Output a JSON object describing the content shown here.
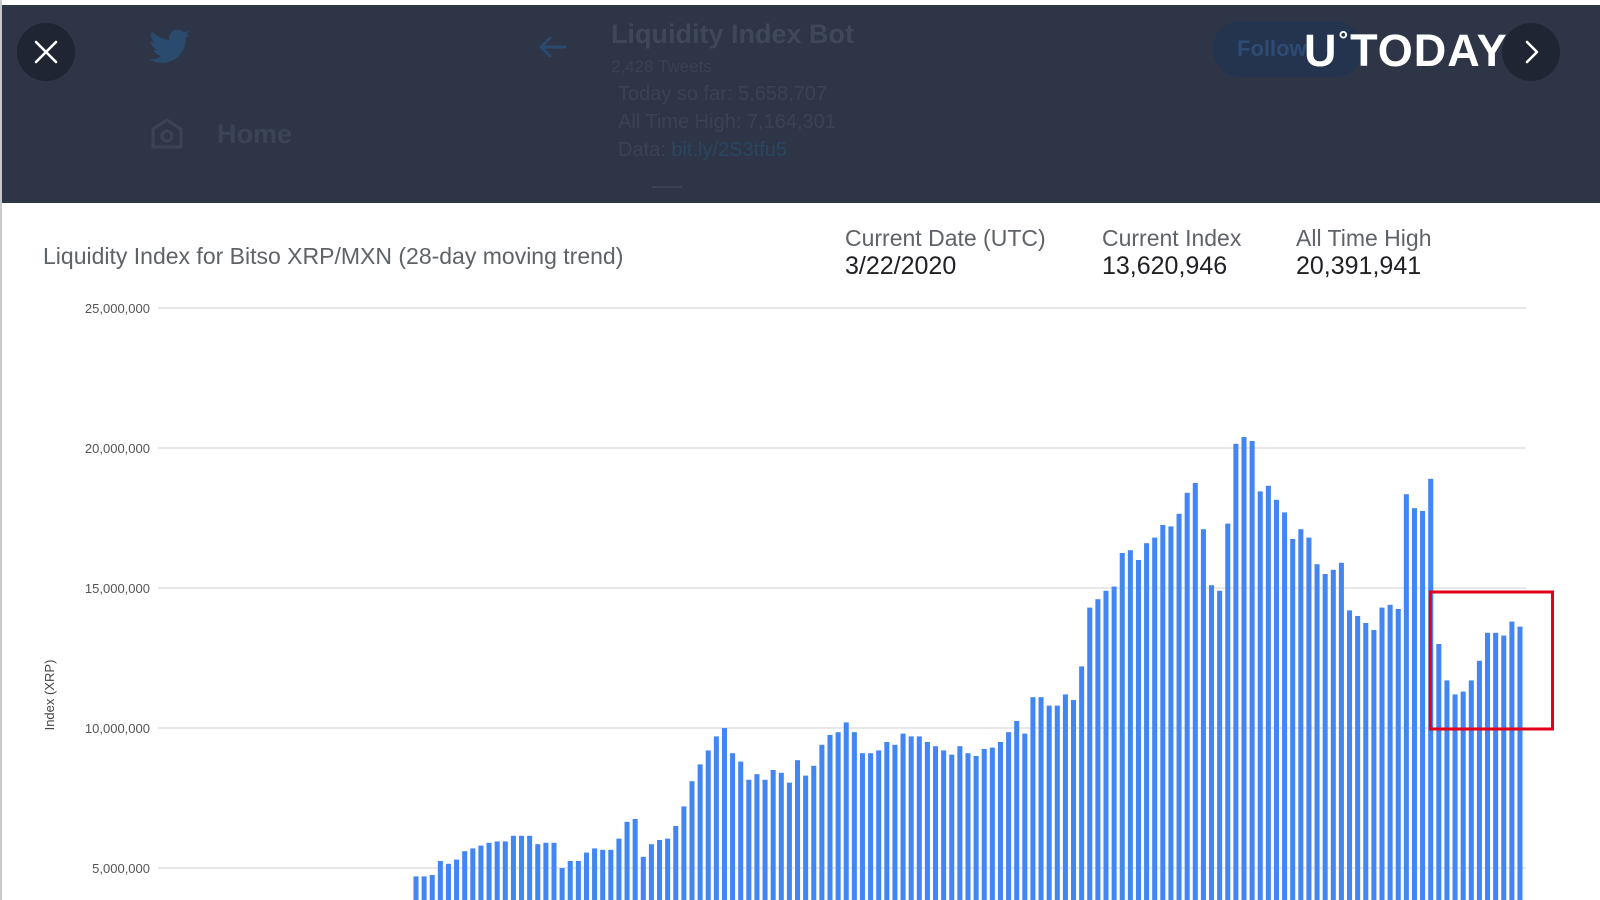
{
  "overlay": {
    "close_icon": "close-icon",
    "twitter_icon": "twitter-bird-icon",
    "home_icon": "home-icon",
    "home_label": "Home",
    "back_icon": "back-arrow-icon",
    "account_name": "Liquidity Index Bot",
    "tweet_count": "2,428 Tweets",
    "tweet_lines": {
      "today": "Today so far: 5,658,707",
      "ath": "All Time High: 7,164,301",
      "data_prefix": "Data: ",
      "data_link": "bit.ly/2S3tfu5"
    },
    "follow_label": "Follow",
    "next_icon": "chevron-right-icon",
    "logo": {
      "left": "U",
      "deg": "°",
      "right": "TODAY"
    }
  },
  "header": {
    "title": "Liquidity Index for Bitso XRP/MXN (28-day moving trend)",
    "stats": [
      {
        "label": "Current Date (UTC)",
        "value": "3/22/2020"
      },
      {
        "label": "Current Index",
        "value": "13,620,946"
      },
      {
        "label": "All Time High",
        "value": "20,391,941"
      }
    ]
  },
  "colors": {
    "bar": "#4285f4",
    "highlight": "#e3001b",
    "grid": "#e0e0e0",
    "overlay": "#2d3546"
  },
  "chart_data": {
    "type": "bar",
    "title": "Liquidity Index for Bitso XRP/MXN (28-day moving trend)",
    "xlabel": "",
    "ylabel": "Index (XRP)",
    "ylim": [
      4500000,
      25000000
    ],
    "yticks": [
      {
        "value": 25000000,
        "label": "25,000,000"
      },
      {
        "value": 20000000,
        "label": "20,000,000"
      },
      {
        "value": 15000000,
        "label": "15,000,000"
      },
      {
        "value": 10000000,
        "label": "10,000,000"
      },
      {
        "value": 5000000,
        "label": "5,000,000"
      }
    ],
    "grid": true,
    "legend": "none",
    "highlight_last_n": 11,
    "values": [
      4700000,
      4700000,
      4750000,
      5250000,
      5150000,
      5300000,
      5600000,
      5700000,
      5800000,
      5900000,
      5950000,
      5950000,
      6150000,
      6150000,
      6150000,
      5850000,
      5900000,
      5900000,
      5000000,
      5250000,
      5250000,
      5550000,
      5700000,
      5650000,
      5650000,
      6050000,
      6650000,
      6750000,
      5400000,
      5850000,
      6000000,
      6050000,
      6500000,
      7200000,
      8100000,
      8700000,
      9200000,
      9700000,
      10000000,
      9100000,
      8800000,
      8150000,
      8350000,
      8150000,
      8500000,
      8400000,
      8050000,
      8850000,
      8300000,
      8650000,
      9400000,
      9750000,
      9850000,
      10200000,
      9850000,
      9100000,
      9100000,
      9200000,
      9500000,
      9400000,
      9800000,
      9700000,
      9700000,
      9500000,
      9350000,
      9200000,
      9050000,
      9350000,
      9100000,
      9000000,
      9250000,
      9300000,
      9500000,
      9850000,
      10250000,
      9800000,
      11100000,
      11100000,
      10800000,
      10800000,
      11200000,
      11000000,
      12200000,
      14300000,
      14600000,
      14900000,
      15050000,
      16250000,
      16350000,
      16000000,
      16600000,
      16800000,
      17250000,
      17200000,
      17650000,
      18400000,
      18750000,
      17100000,
      15100000,
      14900000,
      17300000,
      20150000,
      20391941,
      20250000,
      18450000,
      18650000,
      18150000,
      17700000,
      16750000,
      17100000,
      16800000,
      15850000,
      15500000,
      15650000,
      15900000,
      14200000,
      14000000,
      13750000,
      13500000,
      14300000,
      14400000,
      14250000,
      18350000,
      17850000,
      17750000,
      18900000,
      13000000,
      11700000,
      11200000,
      11300000,
      11700000,
      12400000,
      13400000,
      13400000,
      13300000,
      13800000,
      13620946
    ]
  }
}
